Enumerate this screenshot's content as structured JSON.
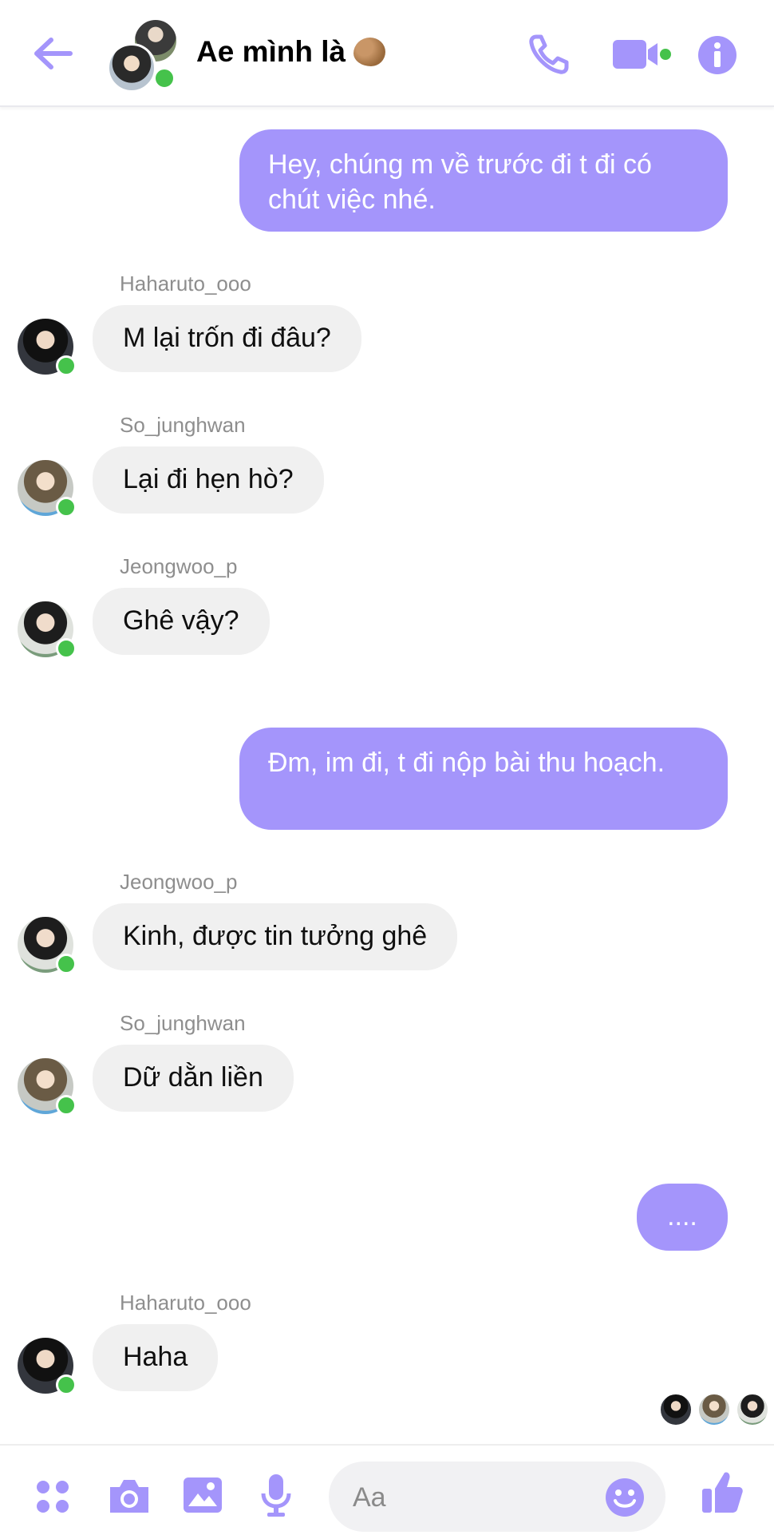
{
  "header": {
    "title": "Ae mình là",
    "accent_color": "#a495fb",
    "online_color": "#45c24b"
  },
  "messages": [
    {
      "from": "me",
      "text": "Hey, chúng m về trước đi t đi có chút việc nhé."
    },
    {
      "from": "Haharuto_ooo",
      "text": "M lại trốn đi đâu?"
    },
    {
      "from": "So_junghwan",
      "text": "Lại đi hẹn hò?"
    },
    {
      "from": "Jeongwoo_p",
      "text": "Ghê vậy?"
    },
    {
      "from": "me",
      "text": "Đm, im đi, t đi nộp bài thu hoạch."
    },
    {
      "from": "Jeongwoo_p",
      "text": "Kinh, được tin tưởng ghê"
    },
    {
      "from": "So_junghwan",
      "text": "Dữ dằn liền"
    },
    {
      "from": "me",
      "text": "...."
    },
    {
      "from": "Haharuto_ooo",
      "text": "Haha"
    }
  ],
  "composer": {
    "placeholder": "Aa"
  },
  "icons": {
    "back": "arrow-left-icon",
    "call": "phone-icon",
    "video": "video-camera-icon",
    "info": "info-icon",
    "apps": "four-dots-icon",
    "camera": "camera-icon",
    "gallery": "image-icon",
    "mic": "microphone-icon",
    "emoji": "smiley-icon",
    "like": "thumbs-up-icon"
  }
}
